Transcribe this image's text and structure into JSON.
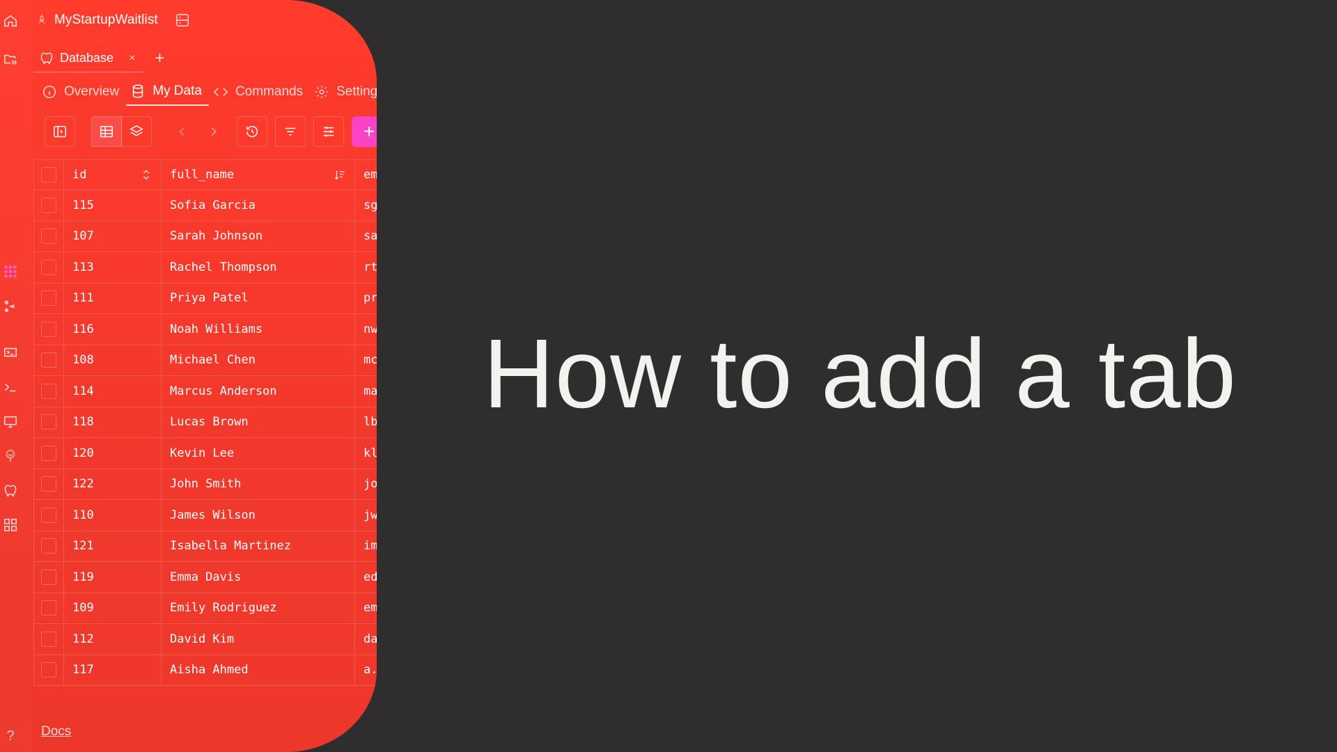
{
  "app": {
    "title": "MyStartupWaitlist"
  },
  "tabs": [
    {
      "label": "Database",
      "close": "×"
    }
  ],
  "tab_add": "+",
  "subnav": [
    {
      "label": "Overview",
      "icon": "info-icon"
    },
    {
      "label": "My Data",
      "icon": "database-icon",
      "active": true
    },
    {
      "label": "Commands",
      "icon": "code-icon"
    },
    {
      "label": "Settings",
      "icon": "gear-icon"
    }
  ],
  "toolbar": {
    "add_label": "+"
  },
  "table": {
    "columns": [
      "id",
      "full_name",
      "em"
    ],
    "rows": [
      {
        "id": "115",
        "full_name": "Sofia Garcia",
        "email": "sg"
      },
      {
        "id": "107",
        "full_name": "Sarah Johnson",
        "email": "sa"
      },
      {
        "id": "113",
        "full_name": "Rachel Thompson",
        "email": "rt"
      },
      {
        "id": "111",
        "full_name": "Priya Patel",
        "email": "pr"
      },
      {
        "id": "116",
        "full_name": "Noah Williams",
        "email": "nw"
      },
      {
        "id": "108",
        "full_name": "Michael Chen",
        "email": "mc"
      },
      {
        "id": "114",
        "full_name": "Marcus Anderson",
        "email": "ma"
      },
      {
        "id": "118",
        "full_name": "Lucas Brown",
        "email": "lb"
      },
      {
        "id": "120",
        "full_name": "Kevin Lee",
        "email": "kl"
      },
      {
        "id": "122",
        "full_name": "John Smith",
        "email": "jo"
      },
      {
        "id": "110",
        "full_name": "James Wilson",
        "email": "jw"
      },
      {
        "id": "121",
        "full_name": "Isabella Martinez",
        "email": "im"
      },
      {
        "id": "119",
        "full_name": "Emma Davis",
        "email": "ed"
      },
      {
        "id": "109",
        "full_name": "Emily Rodriguez",
        "email": "em"
      },
      {
        "id": "112",
        "full_name": "David Kim",
        "email": "da"
      },
      {
        "id": "117",
        "full_name": "Aisha Ahmed",
        "email": "a."
      }
    ]
  },
  "docs_label": "Docs",
  "help_label": "?",
  "headline": "How to add a tab",
  "colors": {
    "panel": "#f0382c",
    "background": "#2f2d2d",
    "accent": "#fb43c6",
    "headline": "#f4f2ee"
  }
}
